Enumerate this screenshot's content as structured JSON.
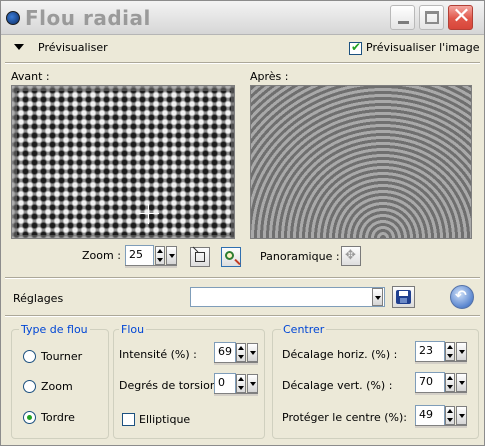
{
  "window": {
    "title": "Flou radial",
    "close_glyph": "✕"
  },
  "preview": {
    "label": "Prévisualiser",
    "checkbox_label": "Prévisualiser l'image",
    "checkbox_checked": true,
    "before_label": "Avant :",
    "after_label": "Après :"
  },
  "zoom": {
    "label": "Zoom :",
    "value": "25",
    "pan_label": "Panoramique :"
  },
  "settings": {
    "label": "Réglages",
    "preset_value": ""
  },
  "blur_type": {
    "title": "Type de flou",
    "options": [
      {
        "label": "Tourner",
        "selected": false
      },
      {
        "label": "Zoom",
        "selected": false
      },
      {
        "label": "Tordre",
        "selected": true
      }
    ]
  },
  "blur": {
    "title": "Flou",
    "intensity_label": "Intensité (%) :",
    "intensity_value": "69",
    "twist_label": "Degrés de torsion :",
    "twist_value": "0",
    "elliptic_label": "Elliptique",
    "elliptic_checked": false
  },
  "center": {
    "title": "Centrer",
    "hoffset_label": "Décalage horiz. (%) :",
    "hoffset_value": "23",
    "voffset_label": "Décalage vert. (%) :",
    "voffset_value": "70",
    "protect_label": "Protéger le centre (%):",
    "protect_value": "49"
  },
  "icons": {
    "app": "app-icon",
    "minimize": "minimize-icon",
    "maximize": "maximize-icon",
    "close": "close-icon",
    "save": "save-disk-icon",
    "reset": "reset-icon",
    "pan": "pan-cross-icon"
  },
  "colors": {
    "group_title": "#0046d5",
    "check_mark": "#21a121",
    "close_button": "#d8463a"
  }
}
